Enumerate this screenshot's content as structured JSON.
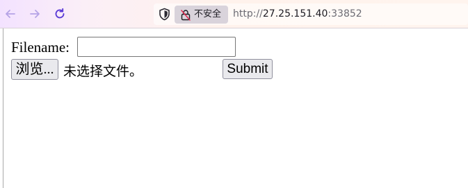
{
  "browser": {
    "security_label": "不安全",
    "url_scheme": "http://",
    "url_host": "27.25.151.40",
    "url_port": ":33852"
  },
  "form": {
    "filename_label": "Filename:",
    "filename_value": "",
    "browse_label": "浏览...",
    "no_file_text": "未选择文件。",
    "submit_label": "Submit"
  },
  "colors": {
    "toolbar_gradient_start": "#f3e2ff",
    "toolbar_gradient_end": "#fff4ee",
    "nav_icon_disabled": "#b5a3e6",
    "nav_icon_active": "#5b3bd6",
    "insecure_pill": "#d9d3db",
    "button_bg": "#e9e9ed"
  },
  "icons": {
    "back": "arrow-left-icon",
    "forward": "arrow-right-icon",
    "reload": "reload-icon",
    "tracking_protection": "shield-icon",
    "insecure": "insecure-lock-icon"
  }
}
